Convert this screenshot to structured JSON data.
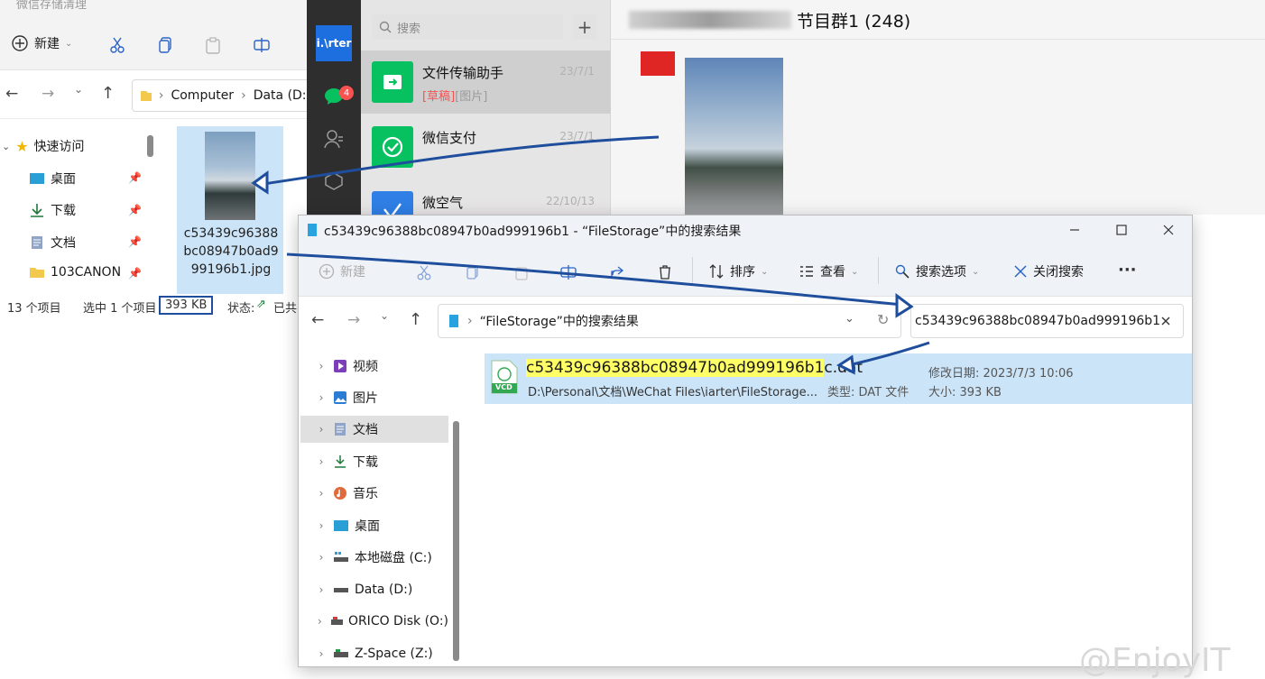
{
  "bg_explorer": {
    "title": "微信存储清理",
    "toolbar": {
      "new_label": "新建"
    },
    "breadcrumb": [
      "Computer",
      "Data (D:)"
    ],
    "quick_access": "快速访问",
    "sidebar": [
      "桌面",
      "下载",
      "文档",
      "103CANON"
    ],
    "file": {
      "name_lines": [
        "c53439c96388",
        "bc08947b0ad9",
        "99196b1.jpg"
      ]
    },
    "status": {
      "count": "13 个项目",
      "selected": "选中 1 个项目",
      "size": "393 KB",
      "state": "状态:",
      "shared": "已共"
    }
  },
  "wechat": {
    "app_label": "i.\\rter",
    "unread_badge": "4",
    "search_placeholder": "搜索",
    "plus": "+",
    "chats": [
      {
        "name": "文件传输助手",
        "time": "23/7/1",
        "draft": "[草稿]",
        "preview": "[图片]"
      },
      {
        "name": "微信支付",
        "time": "23/7/1",
        "preview": ""
      },
      {
        "name": "微空气",
        "time": "22/10/13",
        "preview": ""
      }
    ],
    "chat_title": "节目群1 (248)"
  },
  "search_window": {
    "title": "c53439c96388bc08947b0ad999196b1 - “FileStorage”中的搜索结果",
    "commands": {
      "new": "新建",
      "sort": "排序",
      "view": "查看",
      "search_options": "搜索选项",
      "close_search": "关闭搜索",
      "more": "···"
    },
    "address": "“FileStorage”中的搜索结果",
    "search_value": "c53439c96388bc08947b0ad999196b1",
    "nav_tree": [
      "视频",
      "图片",
      "文档",
      "下载",
      "音乐",
      "桌面",
      "本地磁盘 (C:)",
      "Data (D:)",
      "ORICO Disk (O:)",
      "Z-Space (Z:)"
    ],
    "result": {
      "name_highlight": "c53439c96388bc08947b0ad999196b1",
      "name_rest": "c.dat",
      "path": "D:\\Personal\\文档\\WeChat Files\\iarter\\FileStorage...",
      "type_label": "类型: DAT 文件",
      "modified_label": "修改日期: 2023/7/3 10:06",
      "size_label": "大小: 393 KB",
      "icon_text": "VCD"
    }
  },
  "watermark": "@EnjoyIT",
  "colors": {
    "selection": "#cce4f7",
    "highlight": "#ffff66",
    "accent": "#0067c0",
    "wechat_green": "#07c160",
    "arrow": "#1f4e9c"
  }
}
